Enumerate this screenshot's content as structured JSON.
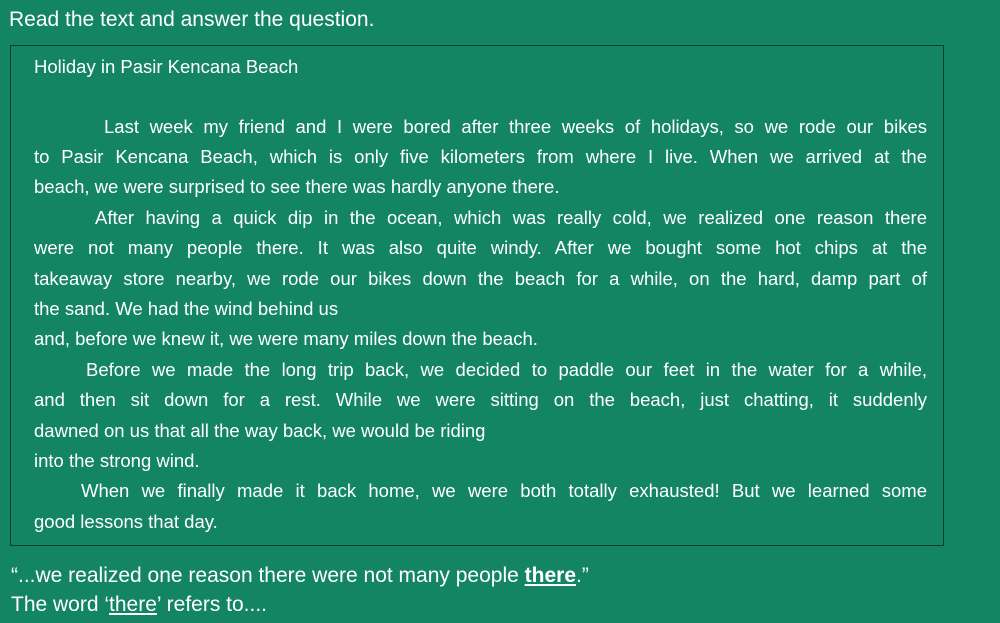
{
  "instruction": "Read the text and answer the question.",
  "passage": {
    "title": "Holiday in Pasir Kencana Beach",
    "lines": [
      "Last week my friend and I were bored after three weeks of holidays, so we rode our bikes",
      "to Pasir Kencana Beach, which is only five kilometers from where I live. When we arrived at the",
      "beach, we were surprised to see there was hardly anyone there.",
      "After having a quick dip in the ocean, which was really cold, we realized one reason there",
      "were not many people there. It was also quite windy. After we bought some hot chips at the",
      "takeaway store nearby, we rode our bikes down the beach for a while, on the hard, damp part of",
      "the sand. We had the wind behind us",
      "and, before we knew it, we were many miles down the beach.",
      "Before we made the long trip back, we decided to paddle our feet in the water for a while,",
      "and then sit down for a rest. While we were sitting on the beach, just chatting, it suddenly",
      "dawned on us that all the way back, we would be riding",
      "into the strong wind.",
      "When we finally made it back home, we were both totally exhausted! But we learned some",
      "good lessons that day."
    ]
  },
  "quote": {
    "before": "“...we realized one reason there were not many people ",
    "highlight": "there",
    "after": ".”"
  },
  "question": {
    "before": "The word ‘",
    "word": "there",
    "after": "’ refers to...."
  }
}
